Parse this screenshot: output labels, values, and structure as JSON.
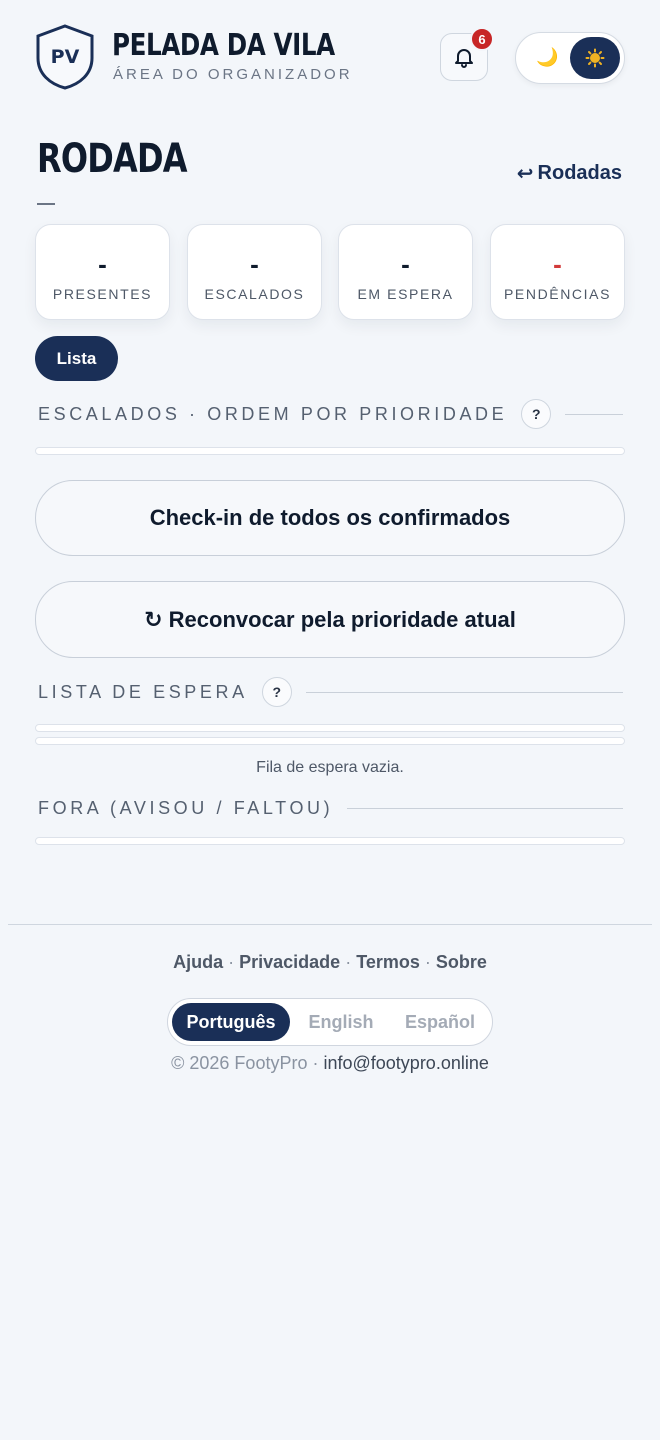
{
  "header": {
    "logo_text": "PV",
    "title": "PELADA DA VILA",
    "subtitle": "ÁREA DO ORGANIZADOR",
    "notification_count": "6",
    "theme_moon": "🌙"
  },
  "page": {
    "title": "RODADA",
    "back_label": "Rodadas",
    "back_arrow": "↩"
  },
  "stats": [
    {
      "value": "-",
      "label": "PRESENTES"
    },
    {
      "value": "-",
      "label": "ESCALADOS"
    },
    {
      "value": "-",
      "label": "EM ESPERA"
    },
    {
      "value": "-",
      "label": "PENDÊNCIAS"
    }
  ],
  "tabs": {
    "lista": "Lista"
  },
  "sections": {
    "escalados": "ESCALADOS · ORDEM POR PRIORIDADE",
    "espera": "LISTA DE ESPERA",
    "fora": "FORA (AVISOU / FALTOU)",
    "help": "?"
  },
  "actions": {
    "checkin_all": "Check-in de todos os confirmados",
    "reconvocar": "↻ Reconvocar pela prioridade atual"
  },
  "empty_waitlist": "Fila de espera vazia.",
  "footer": {
    "links": [
      "Ajuda",
      "Privacidade",
      "Termos",
      "Sobre"
    ],
    "languages": [
      "Português",
      "English",
      "Español"
    ],
    "active_language": "Português",
    "copyright": "© 2026 FootyPro ·",
    "email": "info@footypro.online"
  },
  "colors": {
    "brand_navy": "#1a2f57",
    "alert_red": "#d23a3a",
    "badge_red": "#c72626",
    "background": "#f3f6fa"
  }
}
